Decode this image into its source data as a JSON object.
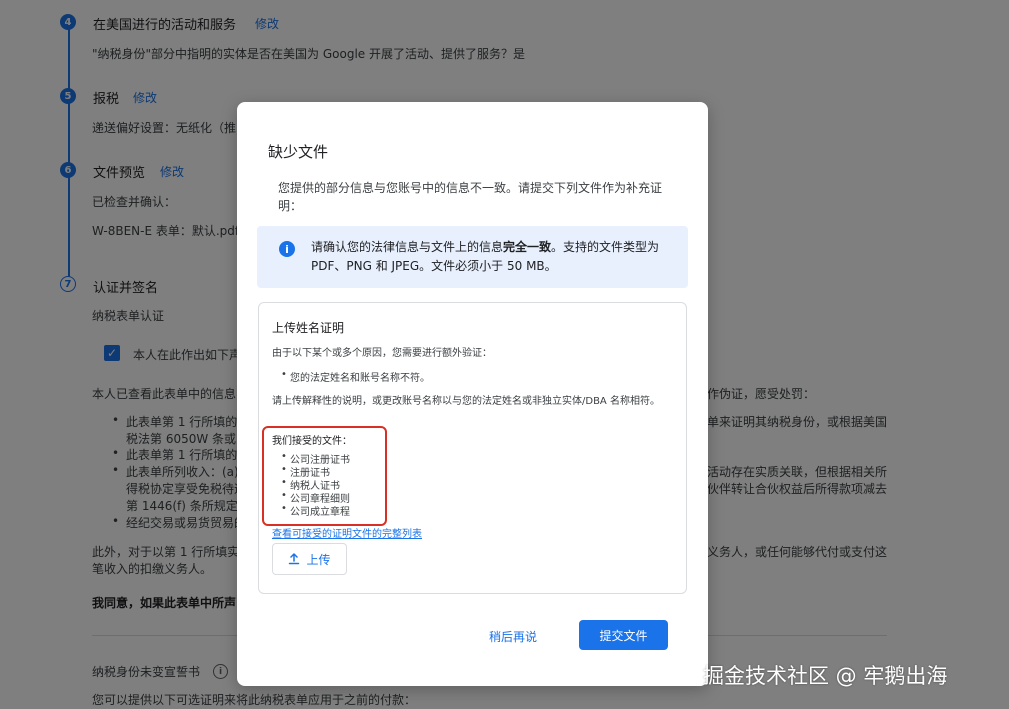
{
  "background": {
    "steps": [
      {
        "number": "4",
        "title": "在美国进行的活动和服务",
        "edit": "修改",
        "text": "\"纳税身份\"部分中指明的实体是否在美国为 Google 开展了活动、提供了服务？是"
      },
      {
        "number": "5",
        "title": "报税",
        "edit": "修改",
        "text": "递送偏好设置：无纸化（推"
      },
      {
        "number": "6",
        "title": "文件预览",
        "edit": "修改",
        "text": "已检查并确认：",
        "text2": "W-8BEN-E 表单：默认.pdf"
      },
      {
        "number": "7",
        "title": "认证并签名",
        "text": "纳税表单认证"
      }
    ],
    "checkbox_label": "本人在此作出如下声",
    "declaration_left": "本人已查看此表单中的信息",
    "declaration_right": "作伪证，愿受处罚：",
    "bullets_left": [
      "此表单第 1 行所填的",
      "税法第 6050W 条或",
      "此表单第 1 行所填的",
      "此表单所列收入：(a)",
      "得税协定享受免税待遇",
      "第 1446(f) 条所规定",
      "经纪交易或易货贸易的"
    ],
    "bullets_right": [
      "单来证明其纳税身份，或根据美国",
      "",
      "",
      "活动存在实质关联，但根据相关所",
      "伙伴转让合伙权益后所得款项减去"
    ],
    "para_left_1": "此外，对于以第 1 行所填实",
    "para_left_2": "笔收入的扣缴义务人。",
    "para_right_1": "义务人，或任何能够代付或支付这",
    "agree_text": "我同意，如果此表单中所声",
    "tax_no_change": "纳税身份未变宣誓书",
    "bottom_text": "您可以提供以下可选证明来将此纳税表单应用于之前的付款："
  },
  "dialog": {
    "title": "缺少文件",
    "description": "您提供的部分信息与您账号中的信息不一致。请提交下列文件作为补充证明：",
    "notice_pre": "请确认您的法律信息与文件上的信息",
    "notice_bold": "完全一致",
    "notice_post": "。支持的文件类型为 PDF、PNG 和 JPEG。文件必须小于 50 MB。",
    "card": {
      "title": "上传姓名证明",
      "reason_intro": "由于以下某个或多个原因，您需要进行额外验证：",
      "reasons": [
        "您的法定姓名和账号名称不符。"
      ],
      "instruction": "请上传解释性的说明，或更改账号名称以与您的法定姓名或非独立实体/DBA 名称相符。",
      "accepted_title": "我们接受的文件：",
      "accepted_docs": [
        "公司注册证书",
        "注册证书",
        "纳税人证书",
        "公司章程细则",
        "公司成立章程"
      ],
      "full_list_link": "查看可接受的证明文件的完整列表",
      "upload_label": "上传"
    },
    "later_label": "稍后再说",
    "submit_label": "提交文件"
  },
  "watermark": "掘金技术社区 @ 牢鹅出海",
  "colors": {
    "accent": "#1a73e8",
    "highlight_box": "#d93025",
    "notice_bg": "#e8f0fe"
  }
}
